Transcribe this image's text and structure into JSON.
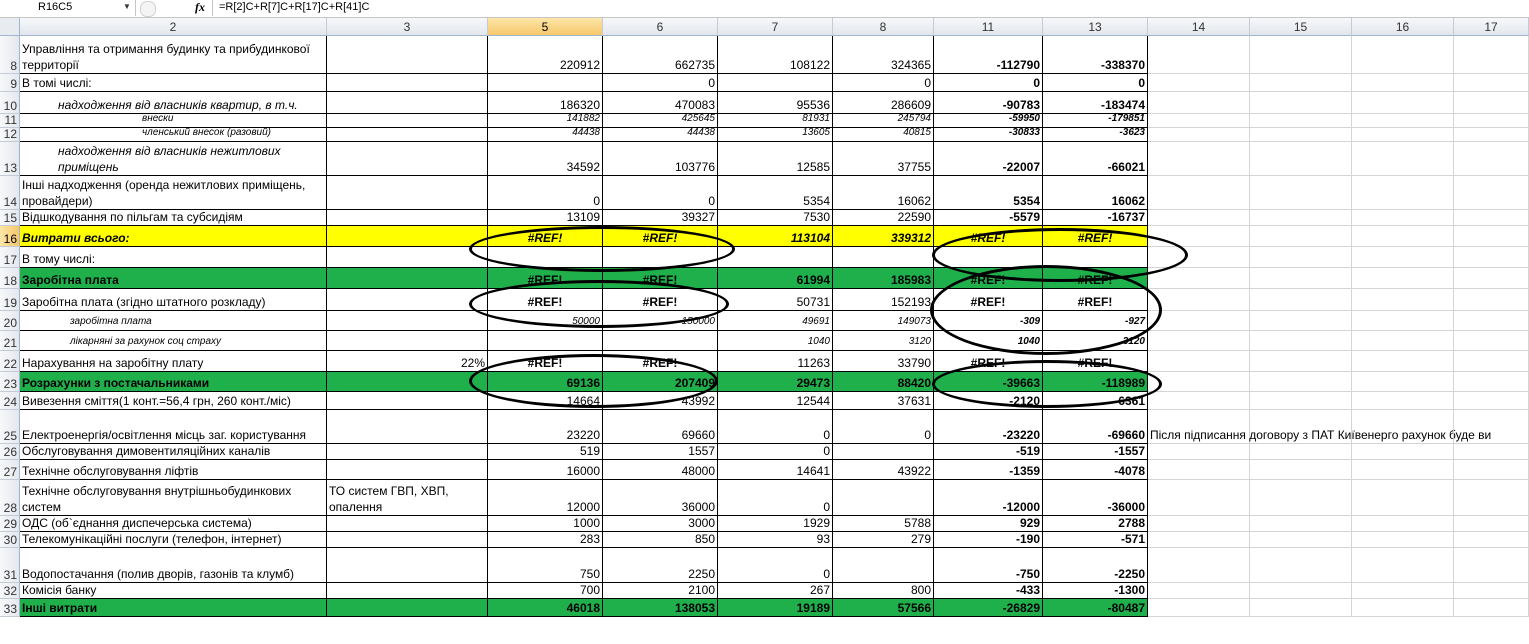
{
  "formula_bar": {
    "name_box": "R16C5",
    "fx_label": "fx",
    "formula": "=R[2]C+R[7]C+R[17]C+R[41]C"
  },
  "column_headers": [
    "2",
    "3",
    "5",
    "6",
    "7",
    "8",
    "11",
    "13",
    "14",
    "15",
    "16",
    "17"
  ],
  "rows": [
    {
      "num": "8",
      "label": "Управління та отримання будинку та прибудинкової территорії",
      "c5": "220912",
      "c6": "662735",
      "c7": "108122",
      "c8": "324365",
      "c11": "-112790",
      "c13": "-338370"
    },
    {
      "num": "9",
      "label": "В томі числі:",
      "c6": "0",
      "c8": "0",
      "c11": "0",
      "c13": "0"
    },
    {
      "num": "10",
      "label": "надходження від власників квартир, в т.ч.",
      "c5": "186320",
      "c6": "470083",
      "c7": "95536",
      "c8": "286609",
      "c11": "-90783",
      "c13": "-183474"
    },
    {
      "num": "11",
      "label": "внески",
      "c5": "141882",
      "c6": "425645",
      "c7": "81931",
      "c8": "245794",
      "c11": "-59950",
      "c13": "-179851"
    },
    {
      "num": "12",
      "label": "членський внесок (разовий)",
      "c5": "44438",
      "c6": "44438",
      "c7": "13605",
      "c8": "40815",
      "c11": "-30833",
      "c13": "-3623"
    },
    {
      "num": "13",
      "label": "надходження від власників нежитлових приміщень",
      "c5": "34592",
      "c6": "103776",
      "c7": "12585",
      "c8": "37755",
      "c11": "-22007",
      "c13": "-66021"
    },
    {
      "num": "14",
      "label": "Інші надходження (оренда нежитлових приміщень, провайдери)",
      "c5": "0",
      "c6": "0",
      "c7": "5354",
      "c8": "16062",
      "c11": "5354",
      "c13": "16062"
    },
    {
      "num": "15",
      "label": "Відшкодування по пільгам та субсидіям",
      "c5": "13109",
      "c6": "39327",
      "c7": "7530",
      "c8": "22590",
      "c11": "-5579",
      "c13": "-16737"
    },
    {
      "num": "16",
      "label": "Витрати всього:",
      "c5": "#REF!",
      "c6": "#REF!",
      "c7": "113104",
      "c8": "339312",
      "c11": "#REF!",
      "c13": "#REF!"
    },
    {
      "num": "17",
      "label": "В тому числі:"
    },
    {
      "num": "18",
      "label": "Заробітна плата",
      "c5": "#REF!",
      "c6": "#REF!",
      "c7": "61994",
      "c8": "185983",
      "c11": "#REF!",
      "c13": "#REF!"
    },
    {
      "num": "19",
      "label": "Заробітна плата (згідно штатного розкладу)",
      "c5": "#REF!",
      "c6": "#REF!",
      "c7": "50731",
      "c8": "152193",
      "c11": "#REF!",
      "c13": "#REF!"
    },
    {
      "num": "20",
      "label": "заробітна плата",
      "c5": "50000",
      "c6": "150000",
      "c7": "49691",
      "c8": "149073",
      "c11": "-309",
      "c13": "-927"
    },
    {
      "num": "21",
      "label": "лікарняні за рахунок соц страху",
      "c7": "1040",
      "c8": "3120",
      "c11": "1040",
      "c13": "3120"
    },
    {
      "num": "22",
      "label": "Нарахування на заробітну плату",
      "c3": "22%",
      "c5": "#REF!",
      "c6": "#REF!",
      "c7": "11263",
      "c8": "33790",
      "c11": "#REF!",
      "c13": "#REF!"
    },
    {
      "num": "23",
      "label": "Розрахунки з постачальниками",
      "c5": "69136",
      "c6": "207409",
      "c7": "29473",
      "c8": "88420",
      "c11": "-39663",
      "c13": "-118989"
    },
    {
      "num": "24",
      "label": "Вивезення сміття(1 конт.=56,4 грн, 260 конт./міс)",
      "c5": "14664",
      "c6": "43992",
      "c7": "12544",
      "c8": "37631",
      "c11": "-2120",
      "c13": "-6361"
    },
    {
      "num": "25",
      "label": "Електроенергія/освітлення місць заг. користування",
      "c5": "23220",
      "c6": "69660",
      "c7": "0",
      "c8": "0",
      "c11": "-23220",
      "c13": "-69660",
      "c14": "Після підписання договору з ПАТ  Київенерго рахунок буде ви"
    },
    {
      "num": "26",
      "label": "Обслуговування димовентиляційних каналів",
      "c5": "519",
      "c6": "1557",
      "c7": "0",
      "c11": "-519",
      "c13": "-1557"
    },
    {
      "num": "27",
      "label": "Технічне обслуговування ліфтів",
      "c5": "16000",
      "c6": "48000",
      "c7": "14641",
      "c8": "43922",
      "c11": "-1359",
      "c13": "-4078"
    },
    {
      "num": "28",
      "label": "Технічне обслуговування внутрішньобудинкових систем",
      "c3": "ТО систем ГВП, ХВП, опалення",
      "c5": "12000",
      "c6": "36000",
      "c7": "0",
      "c11": "-12000",
      "c13": "-36000"
    },
    {
      "num": "29",
      "label": "ОДС (об`єднання диспечерська система)",
      "c5": "1000",
      "c6": "3000",
      "c7": "1929",
      "c8": "5788",
      "c11": "929",
      "c13": "2788"
    },
    {
      "num": "30",
      "label": "Телекомунікаційні послуги (телефон, інтернет)",
      "c5": "283",
      "c6": "850",
      "c7": "93",
      "c8": "279",
      "c11": "-190",
      "c13": "-571"
    },
    {
      "num": "31",
      "label": "Водопостачання (полив дворів, газонів та клумб)",
      "c5": "750",
      "c6": "2250",
      "c7": "0",
      "c11": "-750",
      "c13": "-2250"
    },
    {
      "num": "32",
      "label": "Комісія банку",
      "c5": "700",
      "c6": "2100",
      "c7": "267",
      "c8": "800",
      "c11": "-433",
      "c13": "-1300"
    },
    {
      "num": "33",
      "label": "Інші витрати",
      "c5": "46018",
      "c6": "138053",
      "c7": "19189",
      "c8": "57566",
      "c11": "-26829",
      "c13": "-80487"
    }
  ]
}
